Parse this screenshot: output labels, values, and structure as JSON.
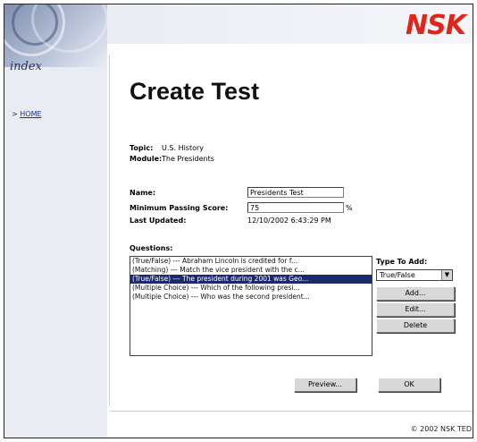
{
  "sidebar": {
    "index_label": "index",
    "home_prefix": ">",
    "home_link": "HOME"
  },
  "header": {
    "logo": "NSK"
  },
  "page": {
    "title": "Create Test",
    "topic_label": "Topic:",
    "topic_value": "U.S. History",
    "module_label": "Module:",
    "module_value": "The Presidents",
    "name_label": "Name:",
    "name_value": "Presidents Test",
    "passing_label": "Minimum Passing Score:",
    "passing_value": "75",
    "passing_unit": "%",
    "updated_label": "Last Updated:",
    "updated_value": "12/10/2002 6:43:29 PM",
    "questions_label": "Questions:",
    "questions": [
      "(True/False) --- Abraham Lincoln is credited for f...",
      "(Matching) --- Match the vice president with the c...",
      "(True/False) --- The president during 2001 was Geo...",
      "(Multiple Choice) --- Which of the following presi...",
      "(Multiple Choice) --- Who was the second president..."
    ],
    "selected_question_index": 2,
    "type_label": "Type To Add:",
    "type_value": "True/False",
    "add_button": "Add...",
    "edit_button": "Edit...",
    "delete_button": "Delete",
    "preview_button": "Preview...",
    "ok_button": "OK"
  },
  "footer": {
    "copyright": "© 2002 NSK TED"
  },
  "colors": {
    "logo": "#e0261b",
    "selection": "#1c2a6b",
    "link": "#1f2fa8"
  }
}
